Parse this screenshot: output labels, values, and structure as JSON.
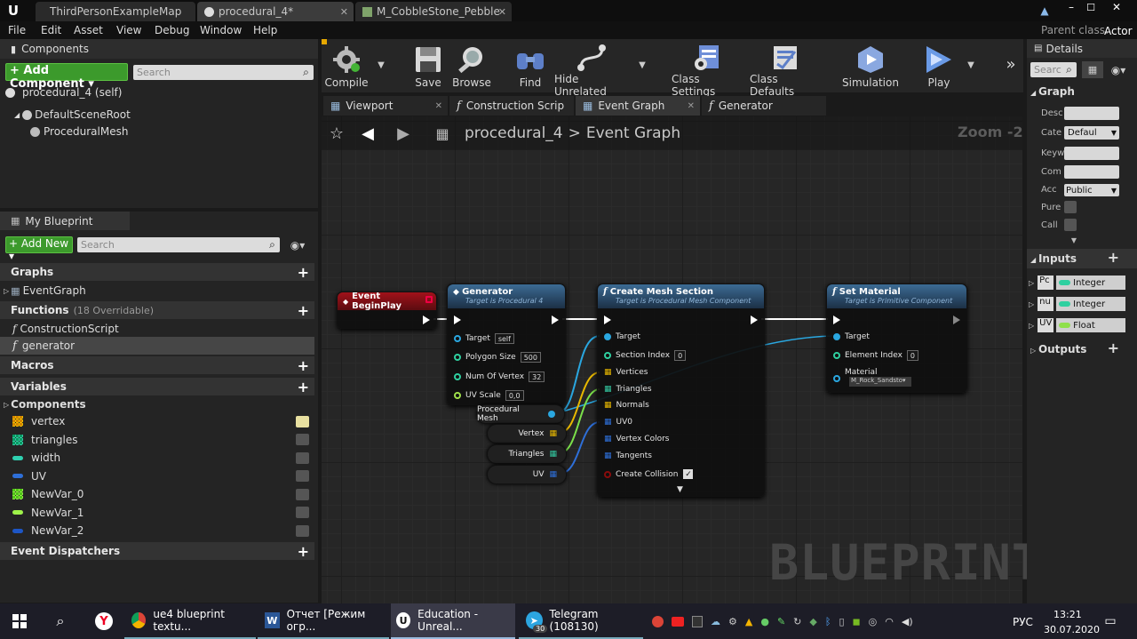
{
  "title_tabs": [
    "ThirdPersonExampleMap",
    "procedural_4*",
    "M_CobbleStone_Pebble"
  ],
  "parent_class_label": "Parent class:",
  "parent_class_value": "Actor",
  "menu": [
    "File",
    "Edit",
    "Asset",
    "View",
    "Debug",
    "Window",
    "Help"
  ],
  "components": {
    "title": "Components",
    "add_button": "+ Add Component ▾",
    "search_placeholder": "Search",
    "self": "procedural_4 (self)",
    "tree": [
      "DefaultSceneRoot",
      "ProceduralMesh"
    ]
  },
  "my_blueprint": {
    "title": "My Blueprint",
    "add_new": "+ Add New ▾",
    "search_placeholder": "Search",
    "graphs_label": "Graphs",
    "event_graph": "EventGraph",
    "functions_label": "Functions",
    "functions_count": "(18 Overridable)",
    "functions": [
      "ConstructionScript",
      "generator"
    ],
    "macros_label": "Macros",
    "variables_label": "Variables",
    "components_label": "Components",
    "variables": [
      {
        "name": "vertex",
        "color": "#e8b800"
      },
      {
        "name": "triangles",
        "color": "#33c7a0"
      },
      {
        "name": "width",
        "color": "#2fd0b0"
      },
      {
        "name": "UV",
        "color": "#2e6fd8"
      },
      {
        "name": "NewVar_0",
        "color": "#8ee04a"
      },
      {
        "name": "NewVar_1",
        "color": "#9ff24a"
      },
      {
        "name": "NewVar_2",
        "color": "#1d56c6"
      }
    ],
    "dispatchers_label": "Event Dispatchers"
  },
  "toolbar": [
    {
      "label": "Compile",
      "icon": "compile-gear-icon"
    },
    {
      "label": "Save",
      "icon": "save-disk-icon"
    },
    {
      "label": "Browse",
      "icon": "magnifier-icon"
    },
    {
      "label": "Find",
      "icon": "binoculars-icon"
    },
    {
      "label": "Hide Unrelated",
      "icon": "hide-unrelated-icon"
    },
    {
      "label": "Class Settings",
      "icon": "class-settings-icon"
    },
    {
      "label": "Class Defaults",
      "icon": "class-defaults-icon"
    },
    {
      "label": "Simulation",
      "icon": "simulation-icon"
    },
    {
      "label": "Play",
      "icon": "play-icon"
    }
  ],
  "graph_tabs": [
    "Viewport",
    "Construction Scrip",
    "Event Graph",
    "Generator"
  ],
  "breadcrumb": {
    "blueprint": "procedural_4",
    "sep": ">",
    "graph": "Event Graph"
  },
  "zoom": "Zoom -2",
  "watermark": "BLUEPRINT",
  "nodes": {
    "begin_play": {
      "title": "Event BeginPlay"
    },
    "generator": {
      "title": "Generator",
      "sub": "Target is Procedural 4",
      "pins": [
        {
          "label": "Target",
          "value": "self"
        },
        {
          "label": "Polygon Size",
          "value": "500"
        },
        {
          "label": "Num Of Vertex",
          "value": "32"
        },
        {
          "label": "UV Scale",
          "value": "0,0"
        }
      ]
    },
    "create_mesh": {
      "title": "Create Mesh Section",
      "sub": "Target is Procedural Mesh Component",
      "pins": [
        "Target",
        "Section Index",
        "Vertices",
        "Triangles",
        "Normals",
        "UV0",
        "Vertex Colors",
        "Tangents",
        "Create Collision"
      ],
      "section_index": "0"
    },
    "set_material": {
      "title": "Set Material",
      "sub": "Target is Primitive Component",
      "pins": [
        "Target",
        "Element Index",
        "Material"
      ],
      "element_index": "0",
      "material_value": "M_Rock_Sandsto▾"
    },
    "vars": [
      "Procedural Mesh",
      "Vertex",
      "Triangles",
      "UV"
    ]
  },
  "details": {
    "title": "Details",
    "search_placeholder": "Searc",
    "graph_label": "Graph",
    "fields": [
      "Desc",
      "Cate",
      "Keyw",
      "Com",
      "Acc",
      "Pure",
      "Call"
    ],
    "category_value": "Defaul",
    "access_value": "Public",
    "inputs_label": "Inputs",
    "inputs": [
      {
        "name": "Pc",
        "type": "Integer",
        "color": "#2fd0a0"
      },
      {
        "name": "nu",
        "type": "Integer",
        "color": "#2fd0a0"
      },
      {
        "name": "UV",
        "type": "Float",
        "color": "#8fe04a"
      }
    ],
    "outputs_label": "Outputs"
  },
  "taskbar": {
    "items": [
      "ue4 blueprint textu...",
      "Отчет [Режим огр...",
      "Education - Unreal...",
      "Telegram (108130)"
    ],
    "lang": "РУС",
    "time": "13:21",
    "date": "30.07.2020",
    "badge": "30"
  }
}
